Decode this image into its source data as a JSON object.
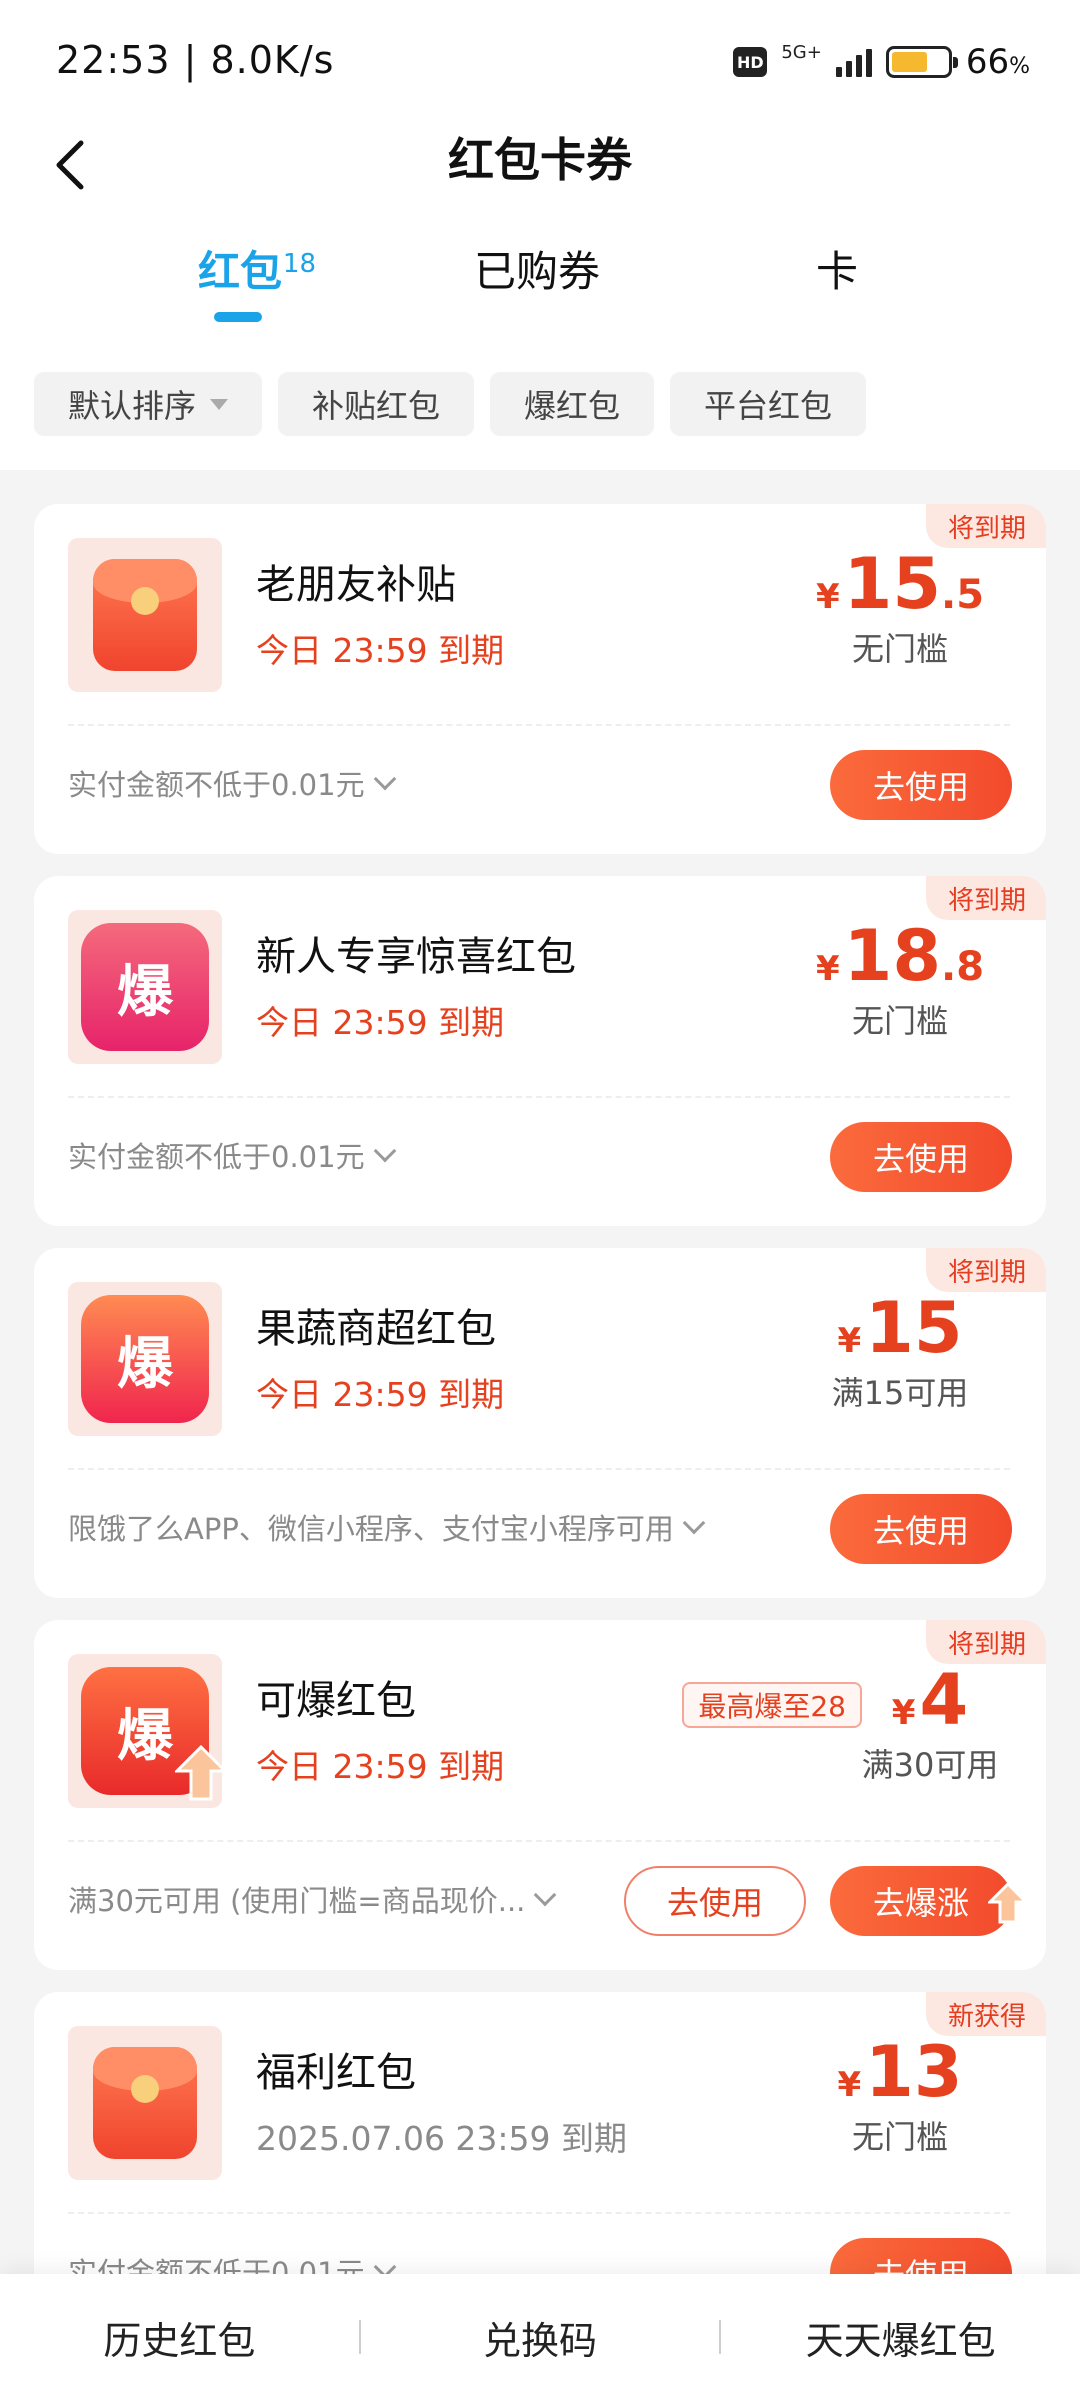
{
  "status_bar": {
    "time": "22:53 | 8.0K/s",
    "hd": "HD",
    "network": "5G+",
    "battery": "66",
    "battery_unit": "%",
    "battery_level": 0.66
  },
  "header": {
    "title": "红包卡券"
  },
  "tabs": [
    {
      "label": "红包",
      "count": "18",
      "active": true
    },
    {
      "label": "已购券"
    },
    {
      "label": "卡"
    }
  ],
  "filters": [
    "默认排序",
    "补贴红包",
    "爆红包",
    "平台红包"
  ],
  "cards": [
    {
      "badge": "将到期",
      "name": "老朋友补贴",
      "expiry": "今日 23:59 到期",
      "currency": "¥",
      "amount_int": "15",
      "amount_dec": ".5",
      "threshold": "无门槛",
      "note": "实付金额不低于0.01元",
      "button": "去使用",
      "icon": "red-envelope-icon"
    },
    {
      "badge": "将到期",
      "name": "新人专享惊喜红包",
      "expiry": "今日 23:59 到期",
      "currency": "¥",
      "amount_int": "18",
      "amount_dec": ".8",
      "threshold": "无门槛",
      "note": "实付金额不低于0.01元",
      "button": "去使用",
      "icon": "bao-pink-icon",
      "icon_text": "爆"
    },
    {
      "badge": "将到期",
      "name": "果蔬商超红包",
      "expiry": "今日 23:59 到期",
      "currency": "¥",
      "amount_int": "15",
      "threshold": "满15可用",
      "note": "限饿了么APP、微信小程序、支付宝小程序可用",
      "button": "去使用",
      "icon": "bao-orange-icon",
      "icon_text": "爆"
    },
    {
      "badge": "将到期",
      "name": "可爆红包",
      "expiry": "今日 23:59 到期",
      "boost_tag": "最高爆至28",
      "currency": "¥",
      "amount_int": "4",
      "threshold": "满30可用",
      "note": "满30元可用 (使用门槛=商品现价...",
      "button": "去使用",
      "button2": "去爆涨",
      "icon": "bao-boost-icon",
      "icon_text": "爆"
    },
    {
      "badge": "新获得",
      "name": "福利红包",
      "expiry": "2025.07.06 23:59 到期",
      "currency": "¥",
      "amount_int": "13",
      "threshold": "无门槛",
      "note": "实付金额不低于0.01元",
      "button": "去使用",
      "icon": "red-envelope-icon"
    }
  ],
  "bottom_bar": [
    "历史红包",
    "兑换码",
    "天天爆红包"
  ],
  "colors": {
    "accent_blue": "#1aa3e8",
    "accent_red": "#e6411f",
    "badge_bg": "#fde7e1",
    "button_start": "#fb6b3c",
    "button_end": "#f24a2c"
  }
}
